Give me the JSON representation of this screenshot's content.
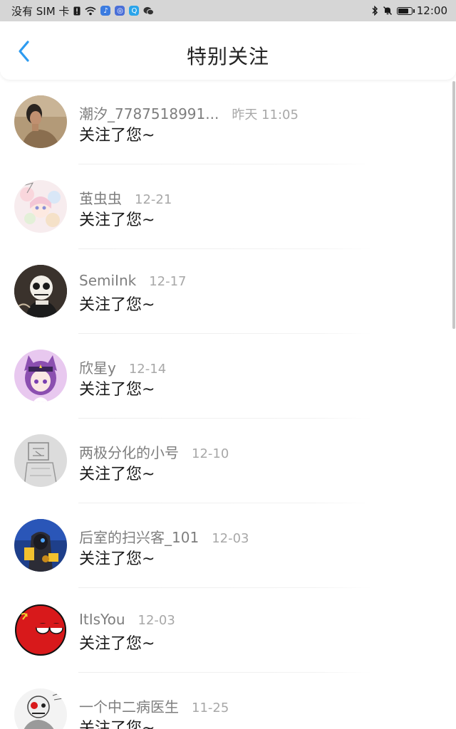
{
  "status_bar": {
    "carrier": "没有 SIM 卡",
    "time": "12:00",
    "battery_level": 0.85,
    "icons": [
      "sim-alert-icon",
      "wifi-icon",
      "music-app-icon",
      "browser-app-icon",
      "qq-app-icon",
      "wechat-app-icon",
      "bluetooth-icon",
      "mute-icon",
      "battery-icon"
    ]
  },
  "header": {
    "title": "特别关注",
    "back_icon": "chevron-left-icon",
    "accent_color": "#2d9bf0"
  },
  "list": {
    "items": [
      {
        "name": "潮汐_7787518991...",
        "time": "昨天 11:05",
        "action": "关注了您~"
      },
      {
        "name": "茧虫虫",
        "time": "12-21",
        "action": "关注了您~"
      },
      {
        "name": "SemiInk",
        "time": "12-17",
        "action": "关注了您~"
      },
      {
        "name": "欣星y",
        "time": "12-14",
        "action": "关注了您~"
      },
      {
        "name": "两极分化的小号",
        "time": "12-10",
        "action": "关注了您~"
      },
      {
        "name": "后室的扫兴客_101",
        "time": "12-03",
        "action": "关注了您~"
      },
      {
        "name": "ItIsYou",
        "time": "12-03",
        "action": "关注了您~"
      },
      {
        "name": "一个中二病医生",
        "time": "11-25",
        "action": "关注了您~"
      }
    ]
  }
}
